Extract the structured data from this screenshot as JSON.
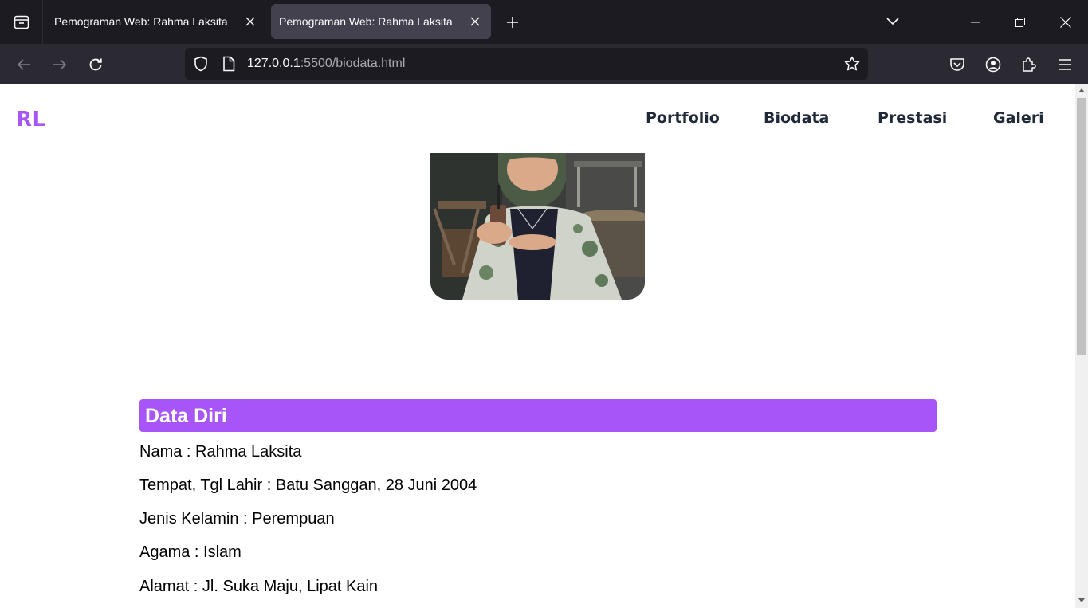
{
  "browser": {
    "tabs": [
      {
        "title": "Pemograman Web: Rahma Laksita",
        "active": false
      },
      {
        "title": "Pemograman Web: Rahma Laksita",
        "active": true
      }
    ],
    "url_host": "127.0.0.1",
    "url_rest": ":5500/biodata.html"
  },
  "site": {
    "logo": "RL",
    "nav": [
      "Portfolio",
      "Biodata",
      "Prestasi",
      "Galeri"
    ],
    "accent_color": "#a855f7"
  },
  "biodata": {
    "heading": "Data Diri",
    "lines": [
      "Nama : Rahma Laksita",
      "Tempat, Tgl Lahir : Batu Sanggan, 28 Juni 2004",
      "Jenis Kelamin : Perempuan",
      "Agama : Islam",
      "Alamat : Jl. Suka Maju, Lipat Kain"
    ]
  }
}
